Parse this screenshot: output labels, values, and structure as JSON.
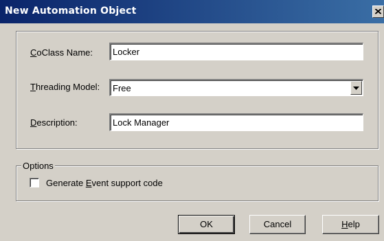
{
  "window": {
    "title": "New Automation Object",
    "close_icon": "close-icon"
  },
  "form": {
    "coclass": {
      "label_pre": "",
      "label_ul": "C",
      "label_post": "oClass Name:",
      "value": "Locker"
    },
    "threading": {
      "label_pre": "",
      "label_ul": "T",
      "label_post": "hreading Model:",
      "value": "Free"
    },
    "description": {
      "label_pre": "",
      "label_ul": "D",
      "label_post": "escription:",
      "value": "Lock Manager"
    }
  },
  "options": {
    "legend": "Options",
    "event_support": {
      "label_pre": "Generate ",
      "label_ul": "E",
      "label_post": "vent support code",
      "checked": false
    }
  },
  "buttons": {
    "ok": "OK",
    "cancel": "Cancel",
    "help_ul": "H",
    "help_post": "elp"
  },
  "colors": {
    "titlebar": "#0a246a",
    "face": "#d4d0c8"
  }
}
